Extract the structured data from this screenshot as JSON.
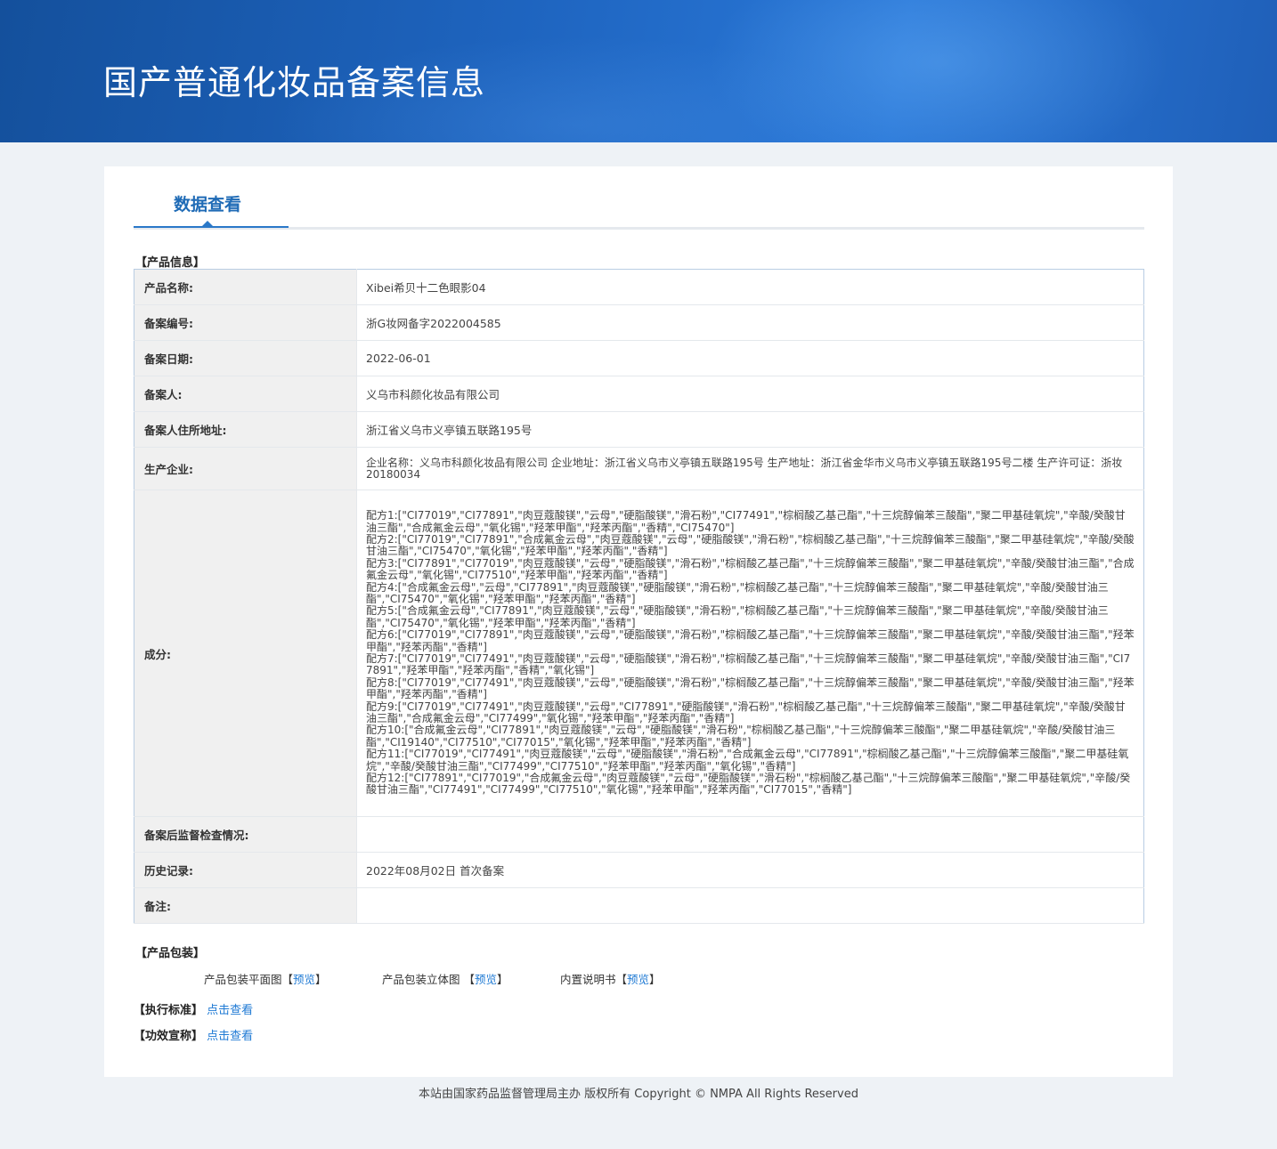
{
  "header": {
    "title": "国产普通化妆品备案信息"
  },
  "tab": {
    "label": "数据查看"
  },
  "sections": {
    "product_info": "【产品信息】",
    "product_package": "【产品包装】"
  },
  "product": {
    "name_label": "产品名称:",
    "name": "Xibei希贝十二色眼影04",
    "record_no_label": "备案编号:",
    "record_no": "浙G妆网备字2022004585",
    "record_date_label": "备案日期:",
    "record_date": "2022-06-01",
    "registrant_label": "备案人:",
    "registrant": "义乌市科颜化妆品有限公司",
    "registrant_addr_label": "备案人住所地址:",
    "registrant_addr": "浙江省义乌市义亭镇五联路195号",
    "manufacturer_label": "生产企业:",
    "manufacturer": "企业名称：义乌市科颜化妆品有限公司 企业地址：浙江省义乌市义亭镇五联路195号 生产地址：浙江省金华市义乌市义亭镇五联路195号二楼 生产许可证：浙妆20180034",
    "ingredients_label": "成分:",
    "ingredients": [
      "配方1:[\"CI77019\",\"CI77891\",\"肉豆蔻酸镁\",\"云母\",\"硬脂酸镁\",\"滑石粉\",\"CI77491\",\"棕榈酸乙基己酯\",\"十三烷醇偏苯三酸酯\",\"聚二甲基硅氧烷\",\"辛酸/癸酸甘油三酯\",\"合成氟金云母\",\"氧化锡\",\"羟苯甲酯\",\"羟苯丙酯\",\"香精\",\"CI75470\"]",
      "配方2:[\"CI77019\",\"CI77891\",\"合成氟金云母\",\"肉豆蔻酸镁\",\"云母\",\"硬脂酸镁\",\"滑石粉\",\"棕榈酸乙基己酯\",\"十三烷醇偏苯三酸酯\",\"聚二甲基硅氧烷\",\"辛酸/癸酸甘油三酯\",\"CI75470\",\"氧化锡\",\"羟苯甲酯\",\"羟苯丙酯\",\"香精\"]",
      "配方3:[\"CI77891\",\"CI77019\",\"肉豆蔻酸镁\",\"云母\",\"硬脂酸镁\",\"滑石粉\",\"棕榈酸乙基己酯\",\"十三烷醇偏苯三酸酯\",\"聚二甲基硅氧烷\",\"辛酸/癸酸甘油三酯\",\"合成氟金云母\",\"氧化锡\",\"CI77510\",\"羟苯甲酯\",\"羟苯丙酯\",\"香精\"]",
      "配方4:[\"合成氟金云母\",\"云母\",\"CI77891\",\"肉豆蔻酸镁\",\"硬脂酸镁\",\"滑石粉\",\"棕榈酸乙基己酯\",\"十三烷醇偏苯三酸酯\",\"聚二甲基硅氧烷\",\"辛酸/癸酸甘油三酯\",\"CI75470\",\"氧化锡\",\"羟苯甲酯\",\"羟苯丙酯\",\"香精\"]",
      "配方5:[\"合成氟金云母\",\"CI77891\",\"肉豆蔻酸镁\",\"云母\",\"硬脂酸镁\",\"滑石粉\",\"棕榈酸乙基己酯\",\"十三烷醇偏苯三酸酯\",\"聚二甲基硅氧烷\",\"辛酸/癸酸甘油三酯\",\"CI75470\",\"氧化锡\",\"羟苯甲酯\",\"羟苯丙酯\",\"香精\"]",
      "配方6:[\"CI77019\",\"CI77891\",\"肉豆蔻酸镁\",\"云母\",\"硬脂酸镁\",\"滑石粉\",\"棕榈酸乙基己酯\",\"十三烷醇偏苯三酸酯\",\"聚二甲基硅氧烷\",\"辛酸/癸酸甘油三酯\",\"羟苯甲酯\",\"羟苯丙酯\",\"香精\"]",
      "配方7:[\"CI77019\",\"CI77491\",\"肉豆蔻酸镁\",\"云母\",\"硬脂酸镁\",\"滑石粉\",\"棕榈酸乙基己酯\",\"十三烷醇偏苯三酸酯\",\"聚二甲基硅氧烷\",\"辛酸/癸酸甘油三酯\",\"CI77891\",\"羟苯甲酯\",\"羟苯丙酯\",\"香精\",\"氧化锡\"]",
      "配方8:[\"CI77019\",\"CI77491\",\"肉豆蔻酸镁\",\"云母\",\"硬脂酸镁\",\"滑石粉\",\"棕榈酸乙基己酯\",\"十三烷醇偏苯三酸酯\",\"聚二甲基硅氧烷\",\"辛酸/癸酸甘油三酯\",\"羟苯甲酯\",\"羟苯丙酯\",\"香精\"]",
      "配方9:[\"CI77019\",\"CI77491\",\"肉豆蔻酸镁\",\"云母\",\"CI77891\",\"硬脂酸镁\",\"滑石粉\",\"棕榈酸乙基己酯\",\"十三烷醇偏苯三酸酯\",\"聚二甲基硅氧烷\",\"辛酸/癸酸甘油三酯\",\"合成氟金云母\",\"CI77499\",\"氧化锡\",\"羟苯甲酯\",\"羟苯丙酯\",\"香精\"]",
      "配方10:[\"合成氟金云母\",\"CI77891\",\"肉豆蔻酸镁\",\"云母\",\"硬脂酸镁\",\"滑石粉\",\"棕榈酸乙基己酯\",\"十三烷醇偏苯三酸酯\",\"聚二甲基硅氧烷\",\"辛酸/癸酸甘油三酯\",\"CI19140\",\"CI77510\",\"CI77015\",\"氧化锡\",\"羟苯甲酯\",\"羟苯丙酯\",\"香精\"]",
      "配方11:[\"CI77019\",\"CI77491\",\"肉豆蔻酸镁\",\"云母\",\"硬脂酸镁\",\"滑石粉\",\"合成氟金云母\",\"CI77891\",\"棕榈酸乙基己酯\",\"十三烷醇偏苯三酸酯\",\"聚二甲基硅氧烷\",\"辛酸/癸酸甘油三酯\",\"CI77499\",\"CI77510\",\"羟苯甲酯\",\"羟苯丙酯\",\"氧化锡\",\"香精\"]",
      "配方12:[\"CI77891\",\"CI77019\",\"合成氟金云母\",\"肉豆蔻酸镁\",\"云母\",\"硬脂酸镁\",\"滑石粉\",\"棕榈酸乙基己酯\",\"十三烷醇偏苯三酸酯\",\"聚二甲基硅氧烷\",\"辛酸/癸酸甘油三酯\",\"CI77491\",\"CI77499\",\"CI77510\",\"氧化锡\",\"羟苯甲酯\",\"羟苯丙酯\",\"CI77015\",\"香精\"]"
    ],
    "supervision_label": "备案后监督检查情况:",
    "supervision": "",
    "history_label": "历史记录:",
    "history": "2022年08月02日 首次备案",
    "remark_label": "备注:",
    "remark": ""
  },
  "package": {
    "flat_label": "产品包装平面图",
    "solid_label": "产品包装立体图",
    "manual_label": "内置说明书",
    "bracket_open": "【",
    "bracket_close": "】",
    "preview": "预览"
  },
  "standard": {
    "label": "【执行标准】",
    "link": "点击查看"
  },
  "efficacy": {
    "label": "【功效宣称】",
    "link": "点击查看"
  },
  "footer": {
    "text": "本站由国家药品监督管理局主办 版权所有 Copyright © NMPA All Rights Reserved"
  }
}
